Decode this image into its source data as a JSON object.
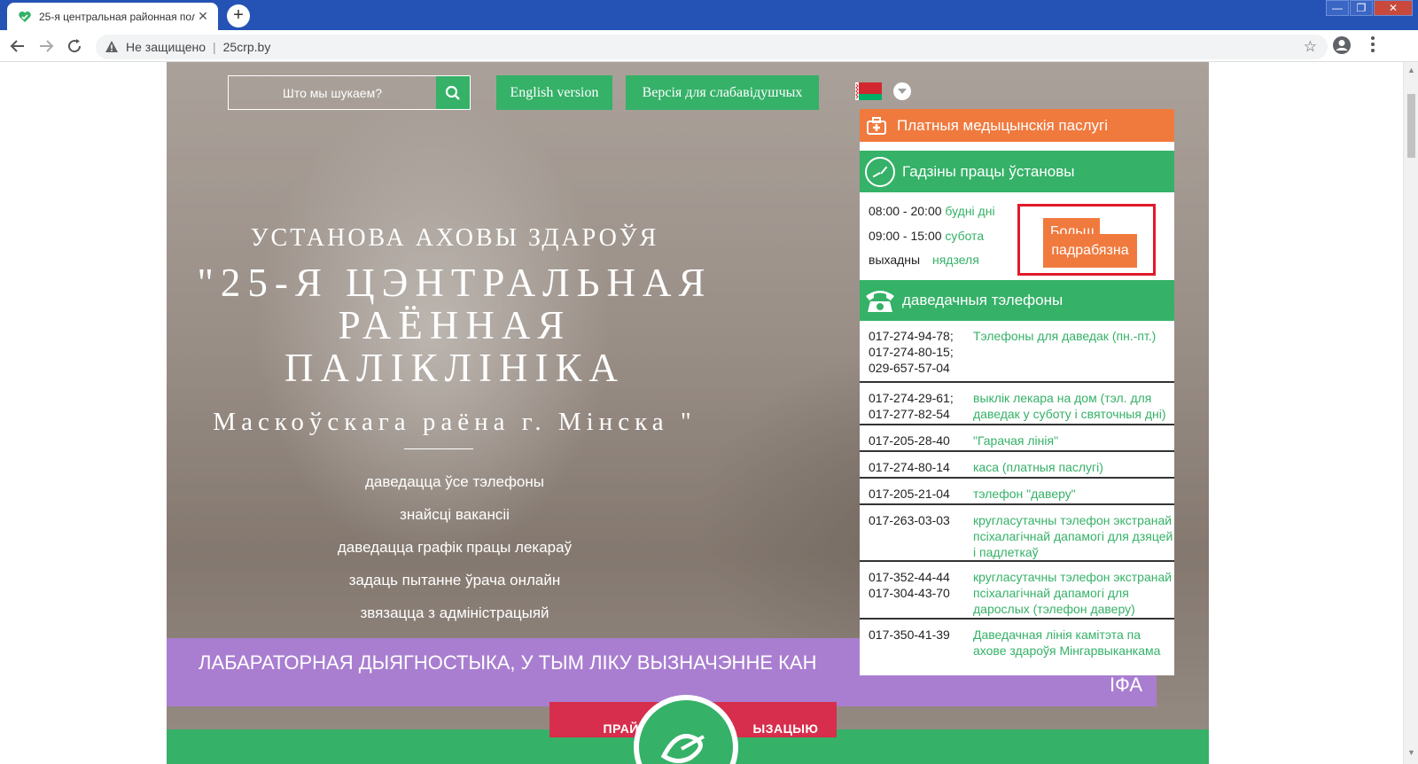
{
  "browser": {
    "tab_title": "25-я центральная районная полик",
    "tab_close": "✕",
    "new_tab": "+",
    "not_secure": "Не защищено",
    "url": "25crp.by",
    "win_min": "—",
    "win_max": "❐",
    "win_close": "✕"
  },
  "header": {
    "search_placeholder": "Што мы шукаем?",
    "english_version": "English version",
    "low_vision_version": "Версія для слабавідушчых"
  },
  "hero": {
    "institution": "УСТАНОВА АХОВЫ ЗДАРОЎЯ",
    "name_line1": "\"25-Я ЦЭНТРАЛЬНАЯ",
    "name_line2": "РАЁННАЯ",
    "name_line3": "ПАЛІКЛІНІКА",
    "district": "Маскоўскага раёна г. Мінска \"",
    "links": [
      "даведацца ўсе тэлефоны",
      "знайсці вакансіі",
      "даведацца графік працы лекараў",
      "задаць пытанне ўрача онлайн",
      "звязацца з адміністрацыяй"
    ]
  },
  "banner": {
    "text": "ЛАБАРАТОРНАЯ ДЫЯГНОСТЫКА, У ТЫМ ЛІКУ ВЫЗНАЧЭННЕ КАН",
    "text_end": "ІФА",
    "button_left": "ПРАЙС",
    "button_right": "ЫЗАЦЫЮ"
  },
  "panel": {
    "paid_services": "Платныя медыцынскія паслугі",
    "hours_title": "Гадзіны працы ўстановы",
    "hours": [
      {
        "time": "08:00 - 20:00",
        "day": "будні дні"
      },
      {
        "time": "09:00 - 15:00",
        "day": "субота"
      },
      {
        "time": "выхадны",
        "day": "нядзеля"
      }
    ],
    "more_partial": "Больш",
    "more_detail": "падрабязна",
    "phones_title": "даведачныя тэлефоны",
    "phones": [
      {
        "numbers": "017-274-94-78;\n017-274-80-15;\n029-657-57-04",
        "desc": "Тэлефоны для даведак (пн.-пт.)"
      },
      {
        "numbers": "017-274-29-61;\n017-277-82-54",
        "desc": "выклік лекара на дом (тэл. для даведак у суботу і святочныя дні)"
      },
      {
        "numbers": "017-205-28-40",
        "desc": "\"Гарачая лінія\""
      },
      {
        "numbers": "017-274-80-14",
        "desc": "каса (платныя паслугі)"
      },
      {
        "numbers": "017-205-21-04",
        "desc": "тэлефон \"даверу\""
      },
      {
        "numbers": "017-263-03-03",
        "desc": "кругласутачны тэлефон экстранай псіхалагічнай дапамогі для дзяцей і падлеткаў"
      },
      {
        "numbers": "017-352-44-44\n017-304-43-70",
        "desc": "кругласутачны тэлефон экстранай псіхалагічнай дапамогі для дарослых (тэлефон даверу)"
      },
      {
        "numbers": "017-350-41-39",
        "desc": "Даведачная лінія камітэта па ахове здароўя Мінгарвыканкама"
      }
    ]
  },
  "colors": {
    "green": "#35b168",
    "orange": "#f07a3e",
    "purple": "#a97ed0",
    "red": "#d62e4c",
    "highlight": "#e01b2a",
    "chrome_blue": "#2553b5"
  }
}
